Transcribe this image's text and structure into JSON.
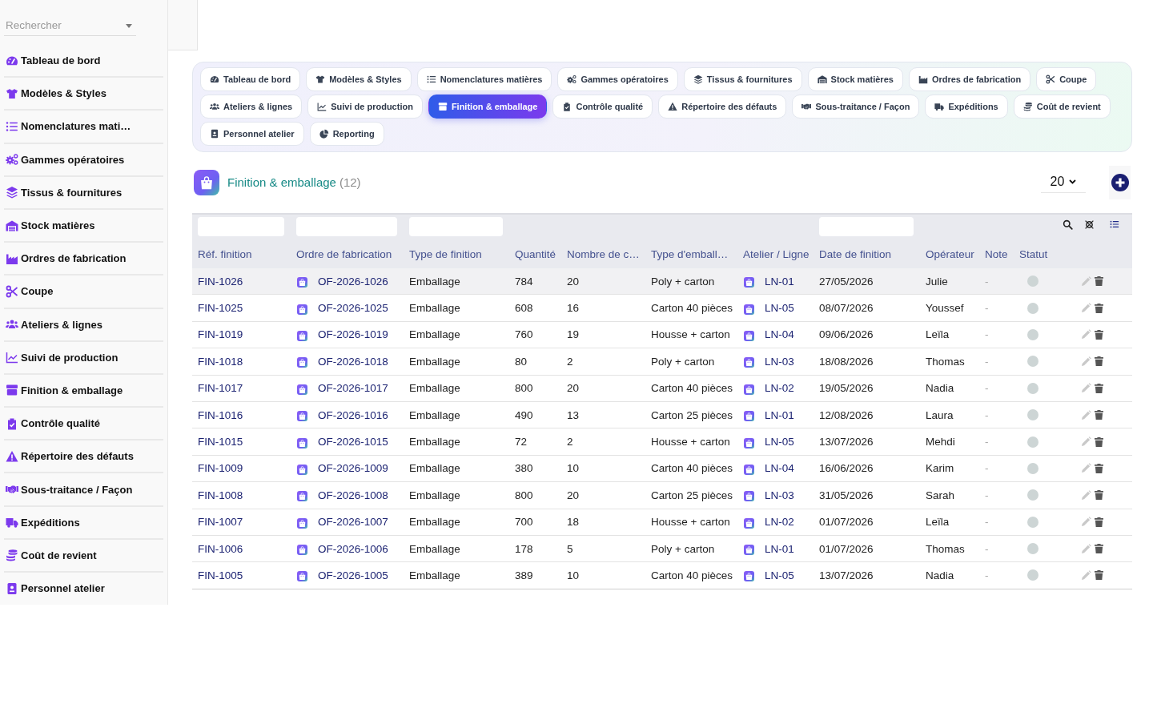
{
  "sidebar": {
    "search": {
      "placeholder": "Rechercher"
    },
    "items": [
      {
        "label": "Tableau de bord"
      },
      {
        "label": "Modèles & Styles"
      },
      {
        "label": "Nomenclatures mati…"
      },
      {
        "label": "Gammes opératoires"
      },
      {
        "label": "Tissus & fournitures"
      },
      {
        "label": "Stock matières"
      },
      {
        "label": "Ordres de fabrication"
      },
      {
        "label": "Coupe"
      },
      {
        "label": "Ateliers & lignes"
      },
      {
        "label": "Suivi de production"
      },
      {
        "label": "Finition & emballage"
      },
      {
        "label": "Contrôle qualité"
      },
      {
        "label": "Répertoire des défauts"
      },
      {
        "label": "Sous-traitance / Façon"
      },
      {
        "label": "Expéditions"
      },
      {
        "label": "Coût de revient"
      },
      {
        "label": "Personnel atelier"
      }
    ]
  },
  "tabs": [
    {
      "label": "Tableau de bord",
      "selected": false
    },
    {
      "label": "Modèles & Styles",
      "selected": false
    },
    {
      "label": "Nomenclatures matières",
      "selected": false
    },
    {
      "label": "Gammes opératoires",
      "selected": false
    },
    {
      "label": "Tissus & fournitures",
      "selected": false
    },
    {
      "label": "Stock matières",
      "selected": false
    },
    {
      "label": "Ordres de fabrication",
      "selected": false
    },
    {
      "label": "Coupe",
      "selected": false
    },
    {
      "label": "Ateliers & lignes",
      "selected": false
    },
    {
      "label": "Suivi de production",
      "selected": false
    },
    {
      "label": "Finition & emballage",
      "selected": true
    },
    {
      "label": "Contrôle qualité",
      "selected": false
    },
    {
      "label": "Répertoire des défauts",
      "selected": false
    },
    {
      "label": "Sous-traitance / Façon",
      "selected": false
    },
    {
      "label": "Expéditions",
      "selected": false
    },
    {
      "label": "Coût de revient",
      "selected": false
    },
    {
      "label": "Personnel atelier",
      "selected": false
    },
    {
      "label": "Reporting",
      "selected": false
    }
  ],
  "section": {
    "title": "Finition & emballage",
    "count": "(12)",
    "page_size": "20"
  },
  "table": {
    "columns": [
      {
        "label": "Réf. finition",
        "kind": "link",
        "filter": true
      },
      {
        "label": "Ordre de fabrication",
        "kind": "icon_link",
        "filter": true
      },
      {
        "label": "Type de finition",
        "kind": "text",
        "filter": true
      },
      {
        "label": "Quantité",
        "kind": "text",
        "filter": false
      },
      {
        "label": "Nombre de c…",
        "kind": "text",
        "filter": false
      },
      {
        "label": "Type d'emball…",
        "kind": "text",
        "filter": false
      },
      {
        "label": "Atelier / Ligne",
        "kind": "icon_link",
        "filter": false
      },
      {
        "label": "Date de finition",
        "kind": "text",
        "filter": true
      },
      {
        "label": "Opérateur",
        "kind": "text",
        "filter": false
      },
      {
        "label": "Note",
        "kind": "muted",
        "filter": false
      },
      {
        "label": "Statut",
        "kind": "status",
        "filter": false
      }
    ],
    "rows": [
      {
        "ref": "FIN-1026",
        "order": "OF-2026-1026",
        "finish_type": "Emballage",
        "quantity": "784",
        "column_5": "20",
        "column_6": "Poly + carton",
        "line": "LN-01",
        "date": "27/05/2026",
        "operator": "Julie",
        "note": "-",
        "selected": true
      },
      {
        "ref": "FIN-1025",
        "order": "OF-2026-1025",
        "finish_type": "Emballage",
        "quantity": "608",
        "column_5": "16",
        "column_6": "Carton 40 pièces",
        "line": "LN-05",
        "date": "08/07/2026",
        "operator": "Youssef",
        "note": "-",
        "selected": false
      },
      {
        "ref": "FIN-1019",
        "order": "OF-2026-1019",
        "finish_type": "Emballage",
        "quantity": "760",
        "column_5": "19",
        "column_6": "Housse + carton",
        "line": "LN-04",
        "date": "09/06/2026",
        "operator": "Leïla",
        "note": "-",
        "selected": false
      },
      {
        "ref": "FIN-1018",
        "order": "OF-2026-1018",
        "finish_type": "Emballage",
        "quantity": "80",
        "column_5": "2",
        "column_6": "Poly + carton",
        "line": "LN-03",
        "date": "18/08/2026",
        "operator": "Thomas",
        "note": "-",
        "selected": false
      },
      {
        "ref": "FIN-1017",
        "order": "OF-2026-1017",
        "finish_type": "Emballage",
        "quantity": "800",
        "column_5": "20",
        "column_6": "Carton 40 pièces",
        "line": "LN-02",
        "date": "19/05/2026",
        "operator": "Nadia",
        "note": "-",
        "selected": false
      },
      {
        "ref": "FIN-1016",
        "order": "OF-2026-1016",
        "finish_type": "Emballage",
        "quantity": "490",
        "column_5": "13",
        "column_6": "Carton 25 pièces",
        "line": "LN-01",
        "date": "12/08/2026",
        "operator": "Laura",
        "note": "-",
        "selected": false
      },
      {
        "ref": "FIN-1015",
        "order": "OF-2026-1015",
        "finish_type": "Emballage",
        "quantity": "72",
        "column_5": "2",
        "column_6": "Housse + carton",
        "line": "LN-05",
        "date": "13/07/2026",
        "operator": "Mehdi",
        "note": "-",
        "selected": false
      },
      {
        "ref": "FIN-1009",
        "order": "OF-2026-1009",
        "finish_type": "Emballage",
        "quantity": "380",
        "column_5": "10",
        "column_6": "Carton 40 pièces",
        "line": "LN-04",
        "date": "16/06/2026",
        "operator": "Karim",
        "note": "-",
        "selected": false
      },
      {
        "ref": "FIN-1008",
        "order": "OF-2026-1008",
        "finish_type": "Emballage",
        "quantity": "800",
        "column_5": "20",
        "column_6": "Carton 25 pièces",
        "line": "LN-03",
        "date": "31/05/2026",
        "operator": "Sarah",
        "note": "-",
        "selected": false
      },
      {
        "ref": "FIN-1007",
        "order": "OF-2026-1007",
        "finish_type": "Emballage",
        "quantity": "700",
        "column_5": "18",
        "column_6": "Housse + carton",
        "line": "LN-02",
        "date": "01/07/2026",
        "operator": "Leïla",
        "note": "-",
        "selected": false
      },
      {
        "ref": "FIN-1006",
        "order": "OF-2026-1006",
        "finish_type": "Emballage",
        "quantity": "178",
        "column_5": "5",
        "column_6": "Poly + carton",
        "line": "LN-01",
        "date": "01/07/2026",
        "operator": "Thomas",
        "note": "-",
        "selected": false
      },
      {
        "ref": "FIN-1005",
        "order": "OF-2026-1005",
        "finish_type": "Emballage",
        "quantity": "389",
        "column_5": "10",
        "column_6": "Carton 40 pièces",
        "line": "LN-05",
        "date": "13/07/2026",
        "operator": "Nadia",
        "note": "-",
        "selected": false
      }
    ]
  }
}
